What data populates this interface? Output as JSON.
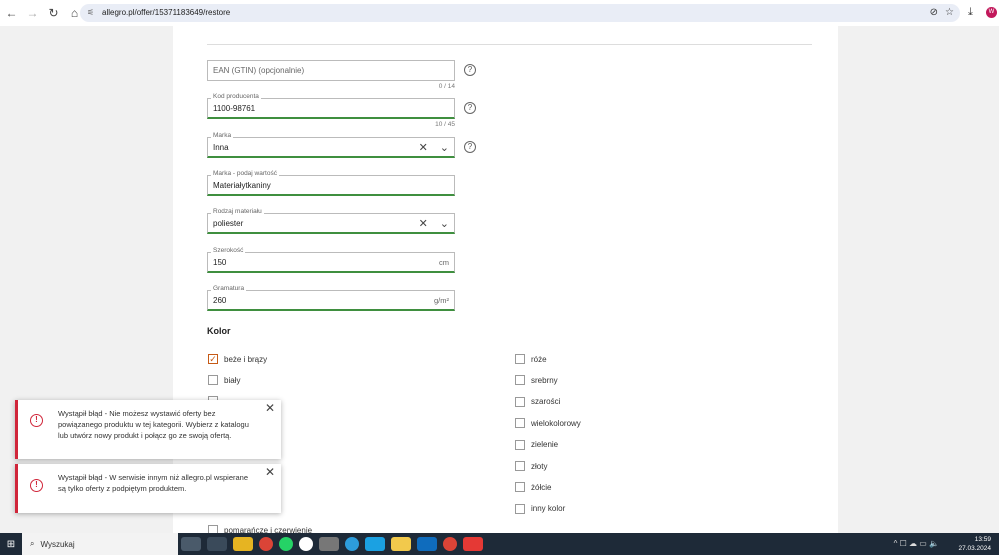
{
  "browser": {
    "url": "allegro.pl/offer/15371183649/restore",
    "avatar": "W"
  },
  "form": {
    "ean": {
      "placeholder": "EAN (GTIN) (opcjonalnie)",
      "counter": "0 / 14"
    },
    "kod": {
      "label": "Kod producenta",
      "value": "1100-98761",
      "counter": "10 / 45"
    },
    "marka": {
      "label": "Marka",
      "value": "Inna"
    },
    "marka_value": {
      "label": "Marka - podaj wartość",
      "value": "Materiałytkaniny"
    },
    "material": {
      "label": "Rodzaj materiału",
      "value": "poliester"
    },
    "szerokosc": {
      "label": "Szerokość",
      "value": "150",
      "unit": "cm"
    },
    "gramatura": {
      "label": "Gramatura",
      "value": "260",
      "unit": "g/m²"
    }
  },
  "kolor": {
    "title": "Kolor",
    "left": [
      {
        "label": "beże i brązy",
        "checked": true
      },
      {
        "label": "biały",
        "checked": false
      },
      {
        "label": "pomarańcze i czerwienie",
        "checked": false
      }
    ],
    "right": [
      {
        "label": "róże"
      },
      {
        "label": "srebrny"
      },
      {
        "label": "szarości"
      },
      {
        "label": "wielokolorowy"
      },
      {
        "label": "zielenie"
      },
      {
        "label": "złoty"
      },
      {
        "label": "żółcie"
      },
      {
        "label": "inny kolor"
      }
    ]
  },
  "toasts": [
    "Wystąpił błąd - Nie możesz wystawić oferty bez powiązanego produktu w tej kategorii. Wybierz z katalogu lub utwórz nowy produkt i połącz go ze swoją ofertą.",
    "Wystąpił błąd - W serwisie innym niż allegro.pl wspierane są tylko oferty z podpiętym produktem."
  ],
  "taskbar": {
    "search": "Wyszukaj",
    "time": "13:59",
    "date": "27.03.2024"
  }
}
